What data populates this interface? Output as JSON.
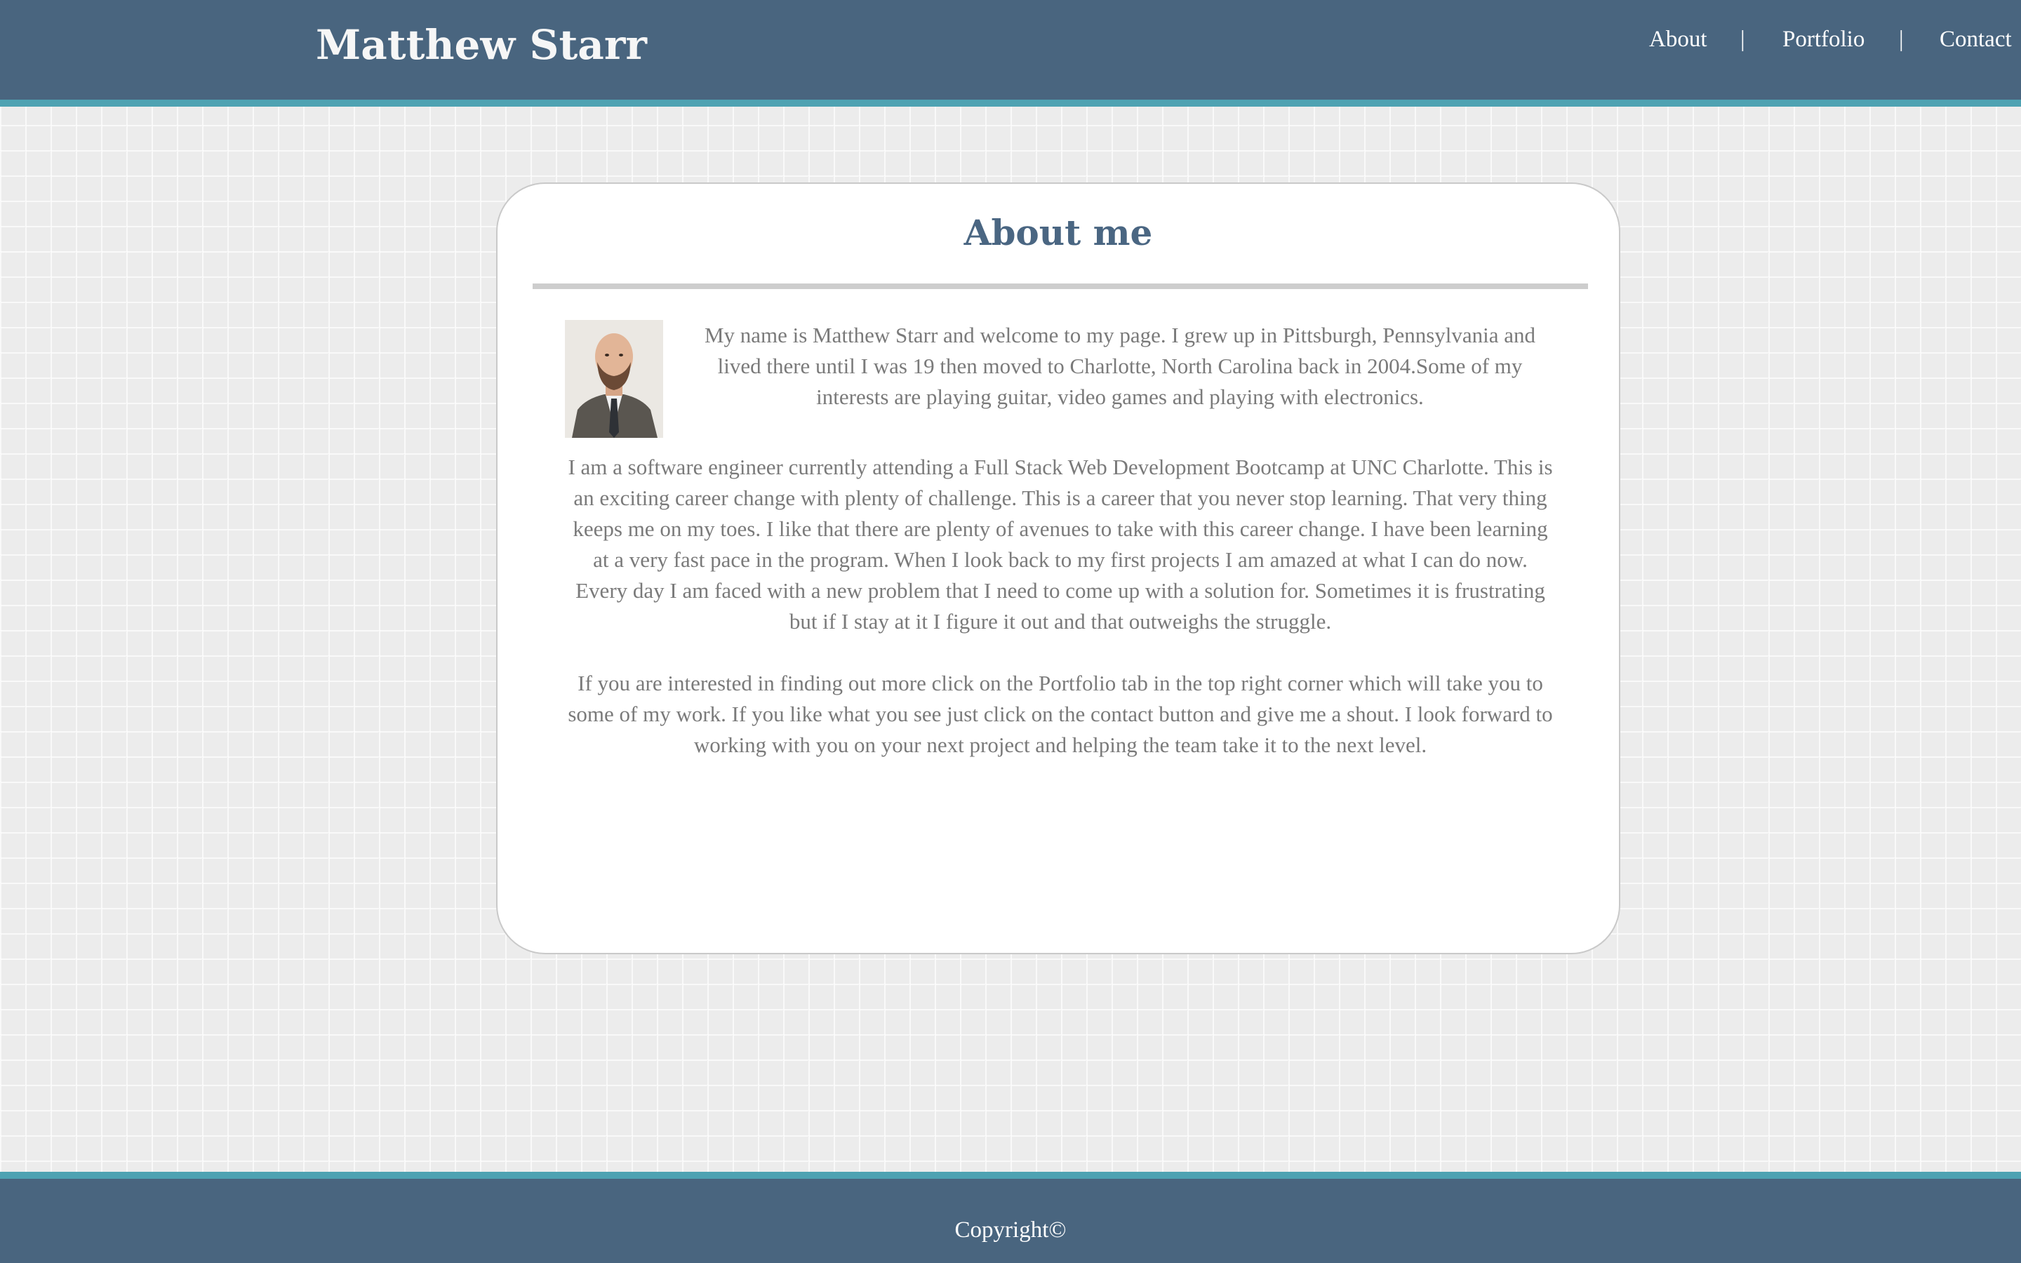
{
  "header": {
    "brand": "Matthew Starr",
    "nav": [
      {
        "label": "About"
      },
      {
        "label": "Portfolio"
      },
      {
        "label": "Contact"
      }
    ],
    "separator": "|"
  },
  "about": {
    "title": "About me",
    "avatar_icon": "profile-photo",
    "paragraphs": [
      "My name is Matthew Starr and welcome to my page. I grew up in Pittsburgh, Pennsylvania and lived there until I was 19 then moved to Charlotte, North Carolina back in 2004.Some of my interests are playing guitar, video games and playing with electronics.",
      "I am a software engineer currently attending a Full Stack Web Development Bootcamp at UNC Charlotte. This is an exciting career change with plenty of challenge. This is a career that you never stop learning. That very thing keeps me on my toes. I like that there are plenty of avenues to take with this career change. I have been learning at a very fast pace in the program. When I look back to my first projects I am amazed at what I can do now. Every day I am faced with a new problem that I need to come up with a solution for. Sometimes it is frustrating but if I stay at it I figure it out and that outweighs the struggle.",
      "If you are interested in finding out more click on the Portfolio tab in the top right corner which will take you to some of my work. If you like what you see just click on the contact button and give me a shout. I look forward to working with you on your next project and helping the team take it to the next level."
    ]
  },
  "footer": {
    "copyright": "Copyright©"
  },
  "colors": {
    "header_bg": "#49657f",
    "accent_stripe": "#4ea2b2",
    "title_color": "#4a6682",
    "body_text": "#7a7a7a"
  }
}
